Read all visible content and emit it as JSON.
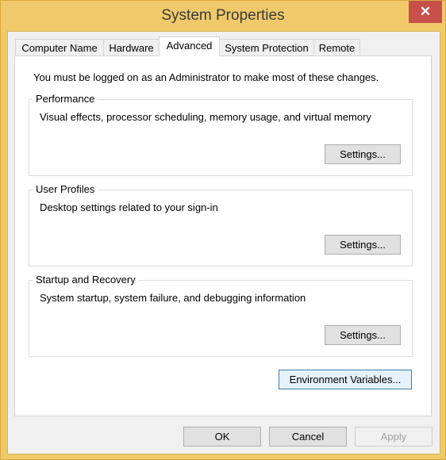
{
  "window": {
    "title": "System Properties",
    "close_icon": "close-icon",
    "frame_color": "#f0c96b",
    "close_color": "#c7504b"
  },
  "tabs": [
    {
      "label": "Computer Name"
    },
    {
      "label": "Hardware"
    },
    {
      "label": "Advanced",
      "active": true
    },
    {
      "label": "System Protection"
    },
    {
      "label": "Remote"
    }
  ],
  "notice": "You must be logged on as an Administrator to make most of these changes.",
  "groups": [
    {
      "label": "Performance",
      "description": "Visual effects, processor scheduling, memory usage, and virtual memory",
      "button": "Settings..."
    },
    {
      "label": "User Profiles",
      "description": "Desktop settings related to your sign-in",
      "button": "Settings..."
    },
    {
      "label": "Startup and Recovery",
      "description": "System startup, system failure, and debugging information",
      "button": "Settings..."
    }
  ],
  "env_button": "Environment Variables...",
  "footer": {
    "ok": "OK",
    "cancel": "Cancel",
    "apply": "Apply"
  }
}
